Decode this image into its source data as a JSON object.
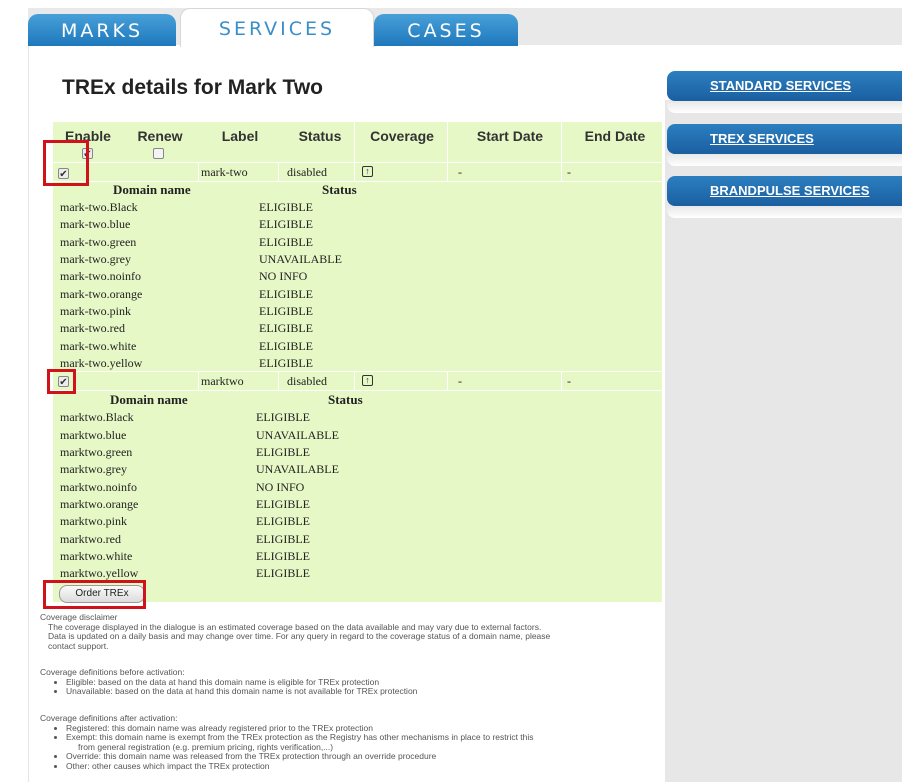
{
  "tabs": [
    {
      "label": "MARKS"
    },
    {
      "label": "SERVICES"
    },
    {
      "label": "CASES"
    }
  ],
  "page_title": "TREx details for Mark Two",
  "table": {
    "headers": [
      "Enable",
      "Renew",
      "Label",
      "Status",
      "Coverage",
      "Start Date",
      "End Date"
    ],
    "domain_header": "Domain name",
    "status_header": "Status",
    "groups": [
      {
        "label": "mark-two",
        "status": "disabled",
        "start_date": "-",
        "end_date": "-",
        "enabled": true,
        "domains": [
          {
            "name": "mark-two.Black",
            "status": "ELIGIBLE"
          },
          {
            "name": "mark-two.blue",
            "status": "ELIGIBLE"
          },
          {
            "name": "mark-two.green",
            "status": "ELIGIBLE"
          },
          {
            "name": "mark-two.grey",
            "status": "UNAVAILABLE"
          },
          {
            "name": "mark-two.noinfo",
            "status": "NO INFO"
          },
          {
            "name": "mark-two.orange",
            "status": "ELIGIBLE"
          },
          {
            "name": "mark-two.pink",
            "status": "ELIGIBLE"
          },
          {
            "name": "mark-two.red",
            "status": "ELIGIBLE"
          },
          {
            "name": "mark-two.white",
            "status": "ELIGIBLE"
          },
          {
            "name": "mark-two.yellow",
            "status": "ELIGIBLE"
          }
        ]
      },
      {
        "label": "marktwo",
        "status": "disabled",
        "start_date": "-",
        "end_date": "-",
        "enabled": true,
        "domains": [
          {
            "name": "marktwo.Black",
            "status": "ELIGIBLE"
          },
          {
            "name": "marktwo.blue",
            "status": "UNAVAILABLE"
          },
          {
            "name": "marktwo.green",
            "status": "ELIGIBLE"
          },
          {
            "name": "marktwo.grey",
            "status": "UNAVAILABLE"
          },
          {
            "name": "marktwo.noinfo",
            "status": "NO INFO"
          },
          {
            "name": "marktwo.orange",
            "status": "ELIGIBLE"
          },
          {
            "name": "marktwo.pink",
            "status": "ELIGIBLE"
          },
          {
            "name": "marktwo.red",
            "status": "ELIGIBLE"
          },
          {
            "name": "marktwo.white",
            "status": "ELIGIBLE"
          },
          {
            "name": "marktwo.yellow",
            "status": "ELIGIBLE"
          }
        ]
      }
    ]
  },
  "order_button": "Order TREx",
  "disclaimer": {
    "title": "Coverage disclaimer",
    "lines": [
      "The coverage displayed in the dialogue is an estimated coverage based on the data available and may vary due to external factors.",
      "Data is updated on a daily basis and may change over time. For any query in regard to the coverage status of a domain name, please",
      "contact support."
    ],
    "before_title": "Coverage definitions before activation:",
    "before_items": [
      "Eligible: based on the data at hand this domain name is eligible for TREx protection",
      "Unavailable: based on the data at hand this domain name is not available for TREx protection"
    ],
    "after_title": "Coverage definitions after activation:",
    "after_items": [
      "Registered: this domain name was already registered prior to the TREx protection",
      "Exempt: this domain name is exempt from the TREx protection as the Registry has other mechanisms in place to restrict this",
      "Override: this domain name was released from the TREx protection through an override procedure",
      "Other: other causes which impact the TREx protection"
    ],
    "after_item2_cont": "from general registration (e.g. premium pricing, rights verification,...)"
  },
  "sidebar": [
    {
      "label": "STANDARD SERVICES"
    },
    {
      "label": "TREX SERVICES"
    },
    {
      "label": "BRANDPULSE SERVICES"
    }
  ],
  "colors": {
    "accent": "#1e78bc",
    "table_bg": "#e6f8c6",
    "highlight": "#d0121b"
  }
}
